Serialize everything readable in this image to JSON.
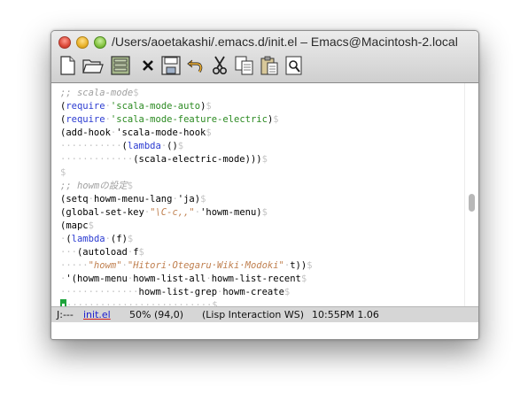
{
  "window": {
    "title": "/Users/aoetakashi/.emacs.d/init.el – Emacs@Macintosh-2.local"
  },
  "toolbar": {
    "buttons": [
      {
        "name": "new-file-icon",
        "label": "New file"
      },
      {
        "name": "open-folder-icon",
        "label": "Open"
      },
      {
        "name": "dired-icon",
        "label": "Dired"
      },
      {
        "name": "close-icon",
        "label": "Close"
      },
      {
        "name": "save-icon",
        "label": "Save"
      },
      {
        "name": "undo-icon",
        "label": "Undo"
      },
      {
        "name": "cut-icon",
        "label": "Cut"
      },
      {
        "name": "copy-icon",
        "label": "Copy"
      },
      {
        "name": "paste-icon",
        "label": "Paste"
      },
      {
        "name": "search-icon",
        "label": "Search"
      }
    ]
  },
  "editor": {
    "lines": [
      [
        {
          "t": ";; scala-mode",
          "c": "cm"
        },
        {
          "t": "$",
          "c": "ws"
        }
      ],
      [
        {
          "t": "(",
          "c": ""
        },
        {
          "t": "require",
          "c": "kw"
        },
        {
          "t": "·",
          "c": "ws"
        },
        {
          "t": "'scala-mode-auto",
          "c": "sym"
        },
        {
          "t": ")",
          "c": ""
        },
        {
          "t": "$",
          "c": "ws"
        }
      ],
      [
        {
          "t": "(",
          "c": ""
        },
        {
          "t": "require",
          "c": "kw"
        },
        {
          "t": "·",
          "c": "ws"
        },
        {
          "t": "'scala-mode-feature-electric",
          "c": "sym"
        },
        {
          "t": ")",
          "c": ""
        },
        {
          "t": "$",
          "c": "ws"
        }
      ],
      [
        {
          "t": "(add-hook",
          "c": ""
        },
        {
          "t": "·",
          "c": "ws"
        },
        {
          "t": "'scala-mode-hook",
          "c": ""
        },
        {
          "t": "$",
          "c": "ws"
        }
      ],
      [
        {
          "t": "···········",
          "c": "ws"
        },
        {
          "t": "(",
          "c": ""
        },
        {
          "t": "lambda",
          "c": "kw"
        },
        {
          "t": "·",
          "c": "ws"
        },
        {
          "t": "()",
          "c": ""
        },
        {
          "t": "$",
          "c": "ws"
        }
      ],
      [
        {
          "t": "·············",
          "c": "ws"
        },
        {
          "t": "(scala-electric-mode)))",
          "c": ""
        },
        {
          "t": "$",
          "c": "ws"
        }
      ],
      [
        {
          "t": "$",
          "c": "ws"
        }
      ],
      [
        {
          "t": ";; howmの設定",
          "c": "cm"
        },
        {
          "t": "$",
          "c": "ws"
        }
      ],
      [
        {
          "t": "(setq",
          "c": ""
        },
        {
          "t": "·",
          "c": "ws"
        },
        {
          "t": "howm-menu-lang",
          "c": ""
        },
        {
          "t": "·",
          "c": "ws"
        },
        {
          "t": "'ja)",
          "c": ""
        },
        {
          "t": "$",
          "c": "ws"
        }
      ],
      [
        {
          "t": "(global-set-key",
          "c": ""
        },
        {
          "t": "·",
          "c": "ws"
        },
        {
          "t": "\"\\C-c,,\"",
          "c": "str"
        },
        {
          "t": "·",
          "c": "ws"
        },
        {
          "t": "'howm-menu)",
          "c": ""
        },
        {
          "t": "$",
          "c": "ws"
        }
      ],
      [
        {
          "t": "(mapc",
          "c": ""
        },
        {
          "t": "$",
          "c": "ws"
        }
      ],
      [
        {
          "t": "·",
          "c": "ws"
        },
        {
          "t": "(",
          "c": ""
        },
        {
          "t": "lambda",
          "c": "kw"
        },
        {
          "t": "·",
          "c": "ws"
        },
        {
          "t": "(f)",
          "c": ""
        },
        {
          "t": "$",
          "c": "ws"
        }
      ],
      [
        {
          "t": "···",
          "c": "ws"
        },
        {
          "t": "(autoload",
          "c": ""
        },
        {
          "t": "·",
          "c": "ws"
        },
        {
          "t": "f",
          "c": ""
        },
        {
          "t": "$",
          "c": "ws"
        }
      ],
      [
        {
          "t": "·····",
          "c": "ws"
        },
        {
          "t": "\"howm\"",
          "c": "str"
        },
        {
          "t": "·",
          "c": "ws"
        },
        {
          "t": "\"Hitori·Otegaru·Wiki·Modoki\"",
          "c": "str"
        },
        {
          "t": "·",
          "c": "ws"
        },
        {
          "t": "t))",
          "c": ""
        },
        {
          "t": "$",
          "c": "ws"
        }
      ],
      [
        {
          "t": "·",
          "c": "ws"
        },
        {
          "t": "'(howm-menu",
          "c": ""
        },
        {
          "t": "·",
          "c": "ws"
        },
        {
          "t": "howm-list-all",
          "c": ""
        },
        {
          "t": "·",
          "c": "ws"
        },
        {
          "t": "howm-list-recent",
          "c": ""
        },
        {
          "t": "$",
          "c": "ws"
        }
      ],
      [
        {
          "t": "··············",
          "c": "ws"
        },
        {
          "t": "howm-list-grep",
          "c": ""
        },
        {
          "t": "·",
          "c": "ws"
        },
        {
          "t": "howm-create",
          "c": ""
        },
        {
          "t": "$",
          "c": "ws"
        }
      ],
      [
        {
          "t": "CURSOR",
          "c": "cursor"
        },
        {
          "t": "··························",
          "c": "ws"
        },
        {
          "t": "$",
          "c": "ws"
        }
      ]
    ]
  },
  "modeline": {
    "state": "J:---",
    "buffer": "init.el",
    "position": "50% (94,0)",
    "modes": "(Lisp Interaction WS)",
    "time": "10:55PM 1.06"
  }
}
